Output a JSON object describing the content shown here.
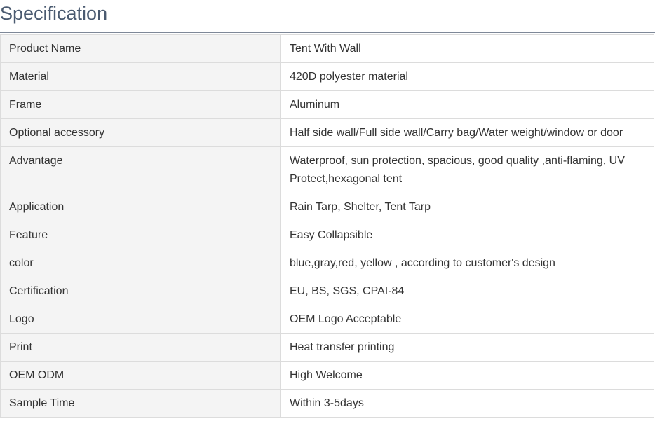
{
  "heading": "Specification",
  "rows": [
    {
      "label": "Product Name",
      "value": "Tent With Wall"
    },
    {
      "label": "Material",
      "value": "420D polyester material"
    },
    {
      "label": "Frame",
      "value": "Aluminum"
    },
    {
      "label": "Optional accessory",
      "value": "Half side wall/Full side wall/Carry bag/Water weight/window or door"
    },
    {
      "label": "Advantage",
      "value": " Waterproof, sun protection, spacious, good quality ,anti-flaming, UV Protect,hexagonal tent"
    },
    {
      "label": "Application",
      "value": "Rain Tarp, Shelter, Tent Tarp"
    },
    {
      "label": "Feature",
      "value": "Easy Collapsible"
    },
    {
      "label": "color",
      "value": "blue,gray,red, yellow , according to customer's design"
    },
    {
      "label": "Certification",
      "value": "EU, BS, SGS, CPAI-84"
    },
    {
      "label": "Logo",
      "value": "OEM Logo Acceptable"
    },
    {
      "label": "Print",
      "value": "Heat transfer printing"
    },
    {
      "label": "OEM ODM",
      "value": "High Welcome"
    },
    {
      "label": "Sample Time",
      "value": "Within 3-5days"
    }
  ]
}
